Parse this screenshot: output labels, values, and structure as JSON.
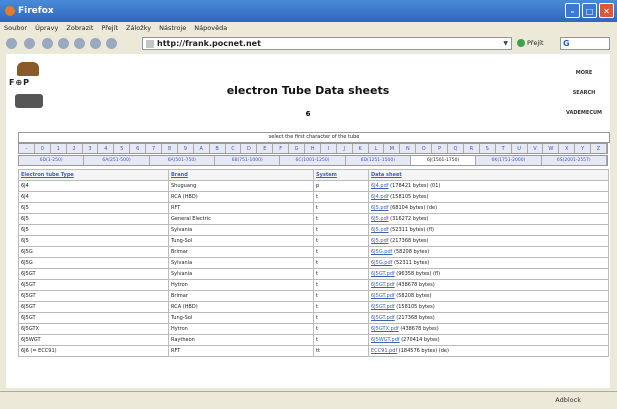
{
  "window": {
    "title": "Firefox"
  },
  "menu": [
    "Soubor",
    "Úpravy",
    "Zobrazit",
    "Přejít",
    "Záložky",
    "Nástroje",
    "Nápověda"
  ],
  "url": "http://frank.pocnet.net",
  "go_label": "Přejít",
  "search_label": "G",
  "page": {
    "logo_text": "F⊕P",
    "title": "electron Tube Data sheets",
    "subline": "6",
    "right_links": [
      "MORE",
      "SEARCH",
      "VADEMECUM"
    ],
    "select_prompt": "select the first character of the tube"
  },
  "chars": [
    "-",
    "0",
    "1",
    "2",
    "3",
    "4",
    "5",
    "6",
    "7",
    "8",
    "9",
    "A",
    "B",
    "C",
    "D",
    "E",
    "F",
    "G",
    "H",
    "I",
    "J",
    "K",
    "L",
    "M",
    "N",
    "O",
    "P",
    "Q",
    "R",
    "S",
    "T",
    "U",
    "V",
    "W",
    "X",
    "Y",
    "Z"
  ],
  "ranges": [
    "6D(1-250)",
    "6A(251-500)",
    "6A(501-750)",
    "6B(751-1000)",
    "6C(1001-1250)",
    "6D(1251-1500)",
    "6J(1501-1750)",
    "6K(1751-2000)",
    "6S(2001-2557)"
  ],
  "current_range_index": 6,
  "columns": [
    "Electron tube Type",
    "Brand",
    "System",
    "Data sheet"
  ],
  "rows": [
    {
      "type": "6J4",
      "brand": "Shuguang",
      "system": "p",
      "sheet": "6J4.pdf",
      "size": "(178421 bytes) (01)"
    },
    {
      "type": "6J4",
      "brand": "RCA (HBD)",
      "system": "t",
      "sheet": "6J4.pdf",
      "size": "(158105 bytes)"
    },
    {
      "type": "6J5",
      "brand": "RFT",
      "system": "t",
      "sheet": "6J5.pdf",
      "size": "(68104 bytes) (de)"
    },
    {
      "type": "6J5",
      "brand": "General Electric",
      "system": "t",
      "sheet": "6J5.pdf",
      "size": "(316272 bytes)"
    },
    {
      "type": "6J5",
      "brand": "Sylvania",
      "system": "t",
      "sheet": "6J5.pdf",
      "size": "(52311 bytes) (fl)"
    },
    {
      "type": "6J5",
      "brand": "Tung-Sol",
      "system": "t",
      "sheet": "6J5.pdf",
      "size": "(217368 bytes)"
    },
    {
      "type": "6J5G",
      "brand": "Brimar",
      "system": "t",
      "sheet": "6J5G.pdf",
      "size": "(58208 bytes)"
    },
    {
      "type": "6J5G",
      "brand": "Sylvania",
      "system": "t",
      "sheet": "6J5G.pdf",
      "size": "(52311 bytes)"
    },
    {
      "type": "6J5GT",
      "brand": "Sylvania",
      "system": "t",
      "sheet": "6J5GT.pdf",
      "size": "(96358 bytes) (fl)"
    },
    {
      "type": "6J5GT",
      "brand": "Hytron",
      "system": "t",
      "sheet": "6J5GT.pdf",
      "size": "(438678 bytes)"
    },
    {
      "type": "6J5GT",
      "brand": "Brimar",
      "system": "t",
      "sheet": "6J5GT.pdf",
      "size": "(58208 bytes)"
    },
    {
      "type": "6J5GT",
      "brand": "RCA (HBD)",
      "system": "t",
      "sheet": "6J5GT.pdf",
      "size": "(158105 bytes)"
    },
    {
      "type": "6J5GT",
      "brand": "Tung-Sol",
      "system": "t",
      "sheet": "6J5GT.pdf",
      "size": "(217368 bytes)"
    },
    {
      "type": "6J5GTX",
      "brand": "Hytron",
      "system": "t",
      "sheet": "6J5GTX.pdf",
      "size": "(438678 bytes)"
    },
    {
      "type": "6J5WGT",
      "brand": "Raytheon",
      "system": "t",
      "sheet": "6J5WGT.pdf",
      "size": "(270414 bytes)"
    },
    {
      "type": "6J6 (= ECC91)",
      "brand": "RFT",
      "system": "tt",
      "sheet": "ECC91.pdf",
      "size": "(184576 bytes) (de)"
    }
  ],
  "status": {
    "adblock": "Adblock"
  }
}
